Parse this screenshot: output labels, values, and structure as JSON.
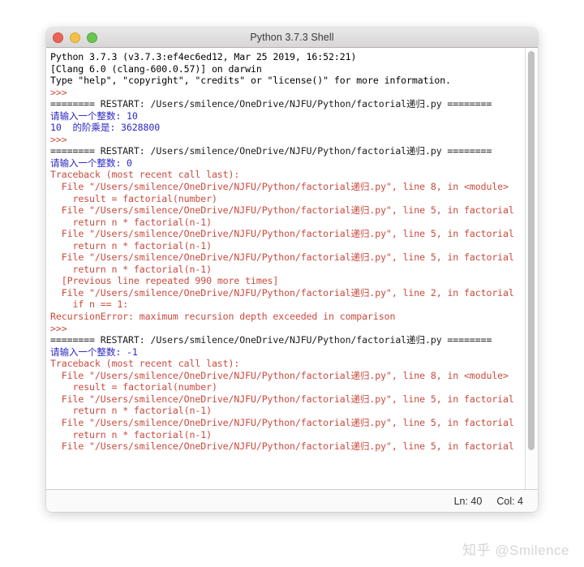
{
  "window": {
    "title": "Python 3.7.3 Shell",
    "traffic_lights": [
      "close",
      "minimize",
      "zoom"
    ]
  },
  "statusbar": {
    "line_label": "Ln: 40",
    "col_label": "Col: 4"
  },
  "watermark": {
    "text": "知乎 @Smilence"
  },
  "colors": {
    "stdout_blue": "#2b26c4",
    "error_red": "#c94a3e",
    "standard_black": "#000000",
    "titlebar": "#d8d6d6"
  },
  "console": {
    "lines": [
      {
        "cls": "c-std",
        "text": "Python 3.7.3 (v3.7.3:ef4ec6ed12, Mar 25 2019, 16:52:21) "
      },
      {
        "cls": "c-std",
        "text": "[Clang 6.0 (clang-600.0.57)] on darwin"
      },
      {
        "cls": "c-std",
        "text": "Type \"help\", \"copyright\", \"credits\" or \"license()\" for more information."
      },
      {
        "cls": "c-err",
        "text": ">>> "
      },
      {
        "cls": "c-rst",
        "text": "======== RESTART: /Users/smilence/OneDrive/NJFU/Python/factorial递归.py ========"
      },
      {
        "cls": "c-out",
        "text": "请输入一个整数: 10"
      },
      {
        "cls": "c-out",
        "text": "10  的阶乘是: 3628800"
      },
      {
        "cls": "c-err",
        "text": ">>> "
      },
      {
        "cls": "c-rst",
        "text": "======== RESTART: /Users/smilence/OneDrive/NJFU/Python/factorial递归.py ========"
      },
      {
        "cls": "c-out",
        "text": "请输入一个整数: 0"
      },
      {
        "cls": "c-err",
        "text": "Traceback (most recent call last):"
      },
      {
        "cls": "c-err",
        "text": "  File \"/Users/smilence/OneDrive/NJFU/Python/factorial递归.py\", line 8, in <module>"
      },
      {
        "cls": "c-err",
        "text": "    result = factorial(number)"
      },
      {
        "cls": "c-err",
        "text": "  File \"/Users/smilence/OneDrive/NJFU/Python/factorial递归.py\", line 5, in factorial"
      },
      {
        "cls": "c-err",
        "text": "    return n * factorial(n-1)"
      },
      {
        "cls": "c-err",
        "text": "  File \"/Users/smilence/OneDrive/NJFU/Python/factorial递归.py\", line 5, in factorial"
      },
      {
        "cls": "c-err",
        "text": "    return n * factorial(n-1)"
      },
      {
        "cls": "c-err",
        "text": "  File \"/Users/smilence/OneDrive/NJFU/Python/factorial递归.py\", line 5, in factorial"
      },
      {
        "cls": "c-err",
        "text": "    return n * factorial(n-1)"
      },
      {
        "cls": "c-err",
        "text": "  [Previous line repeated 990 more times]"
      },
      {
        "cls": "c-err",
        "text": "  File \"/Users/smilence/OneDrive/NJFU/Python/factorial递归.py\", line 2, in factorial"
      },
      {
        "cls": "c-err",
        "text": "    if n == 1:"
      },
      {
        "cls": "c-err",
        "text": "RecursionError: maximum recursion depth exceeded in comparison"
      },
      {
        "cls": "c-err",
        "text": ">>> "
      },
      {
        "cls": "c-rst",
        "text": "======== RESTART: /Users/smilence/OneDrive/NJFU/Python/factorial递归.py ========"
      },
      {
        "cls": "c-out",
        "text": "请输入一个整数: -1"
      },
      {
        "cls": "c-err",
        "text": "Traceback (most recent call last):"
      },
      {
        "cls": "c-err",
        "text": "  File \"/Users/smilence/OneDrive/NJFU/Python/factorial递归.py\", line 8, in <module>"
      },
      {
        "cls": "c-err",
        "text": "    result = factorial(number)"
      },
      {
        "cls": "c-err",
        "text": "  File \"/Users/smilence/OneDrive/NJFU/Python/factorial递归.py\", line 5, in factorial"
      },
      {
        "cls": "c-err",
        "text": "    return n * factorial(n-1)"
      },
      {
        "cls": "c-err",
        "text": "  File \"/Users/smilence/OneDrive/NJFU/Python/factorial递归.py\", line 5, in factorial"
      },
      {
        "cls": "c-err",
        "text": "    return n * factorial(n-1)"
      },
      {
        "cls": "c-err",
        "text": "  File \"/Users/smilence/OneDrive/NJFU/Python/factorial递归.py\", line 5, in factorial"
      }
    ]
  }
}
